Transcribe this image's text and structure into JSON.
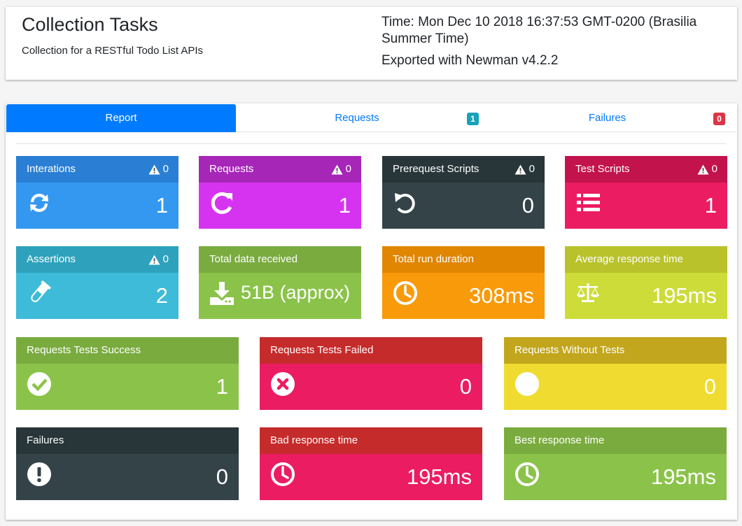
{
  "header": {
    "title": "Collection Tasks",
    "description": "Collection for a RESTful Todo List APIs",
    "time": "Time: Mon Dec 10 2018 16:37:53 GMT-0200 (Brasilia Summer Time)",
    "exported": "Exported with Newman v4.2.2"
  },
  "tabs": [
    {
      "label": "Report",
      "active": true
    },
    {
      "label": "Requests",
      "badge": "1",
      "badge_color": "#17a2b8"
    },
    {
      "label": "Failures",
      "badge": "0",
      "badge_color": "#dc3545"
    }
  ],
  "row1": [
    {
      "title": "Interations",
      "warnings": "0",
      "value": "1",
      "icon": "sync-icon",
      "head_color": "#2a7fd4",
      "body_color": "#3498f0"
    },
    {
      "title": "Requests",
      "warnings": "0",
      "value": "1",
      "icon": "redo-icon",
      "head_color": "#a626b8",
      "body_color": "#d633f0"
    },
    {
      "title": "Prerequest Scripts",
      "warnings": "0",
      "value": "0",
      "icon": "undo-icon",
      "head_color": "#283539",
      "body_color": "#344348"
    },
    {
      "title": "Test Scripts",
      "warnings": "0",
      "value": "1",
      "icon": "list-icon",
      "head_color": "#c2134d",
      "body_color": "#eb1c62"
    }
  ],
  "row2": [
    {
      "title": "Assertions",
      "warnings": "0",
      "value": "2",
      "icon": "flask-icon",
      "head_color": "#2ea2bc",
      "body_color": "#3ebbd8"
    },
    {
      "title": "Total data received",
      "value": "51B (approx)",
      "icon": "download-icon",
      "head_color": "#7aab3f",
      "body_color": "#8bc34a"
    },
    {
      "title": "Total run duration",
      "value": "308ms",
      "icon": "clock-icon",
      "head_color": "#e08600",
      "body_color": "#f89a0a"
    },
    {
      "title": "Average response time",
      "value": "195ms",
      "icon": "balance-icon",
      "head_color": "#b9c22a",
      "body_color": "#cddc39"
    }
  ],
  "row3": [
    {
      "title": "Requests Tests Success",
      "value": "1",
      "icon": "check-circle-icon",
      "head_color": "#7aab3f",
      "body_color": "#8bc34a"
    },
    {
      "title": "Requests Tests Failed",
      "value": "0",
      "icon": "times-circle-icon",
      "head_color": "#c62b2b",
      "body_color": "#eb1c62"
    },
    {
      "title": "Requests Without Tests",
      "value": "0",
      "icon": "circle-icon",
      "head_color": "#c2a61d",
      "body_color": "#f0dc30"
    }
  ],
  "row4": [
    {
      "title": "Failures",
      "value": "0",
      "icon": "exclamation-circle-icon",
      "head_color": "#283539",
      "body_color": "#344348"
    },
    {
      "title": "Bad response time",
      "value": "195ms",
      "icon": "clock-icon",
      "head_color": "#c62b2b",
      "body_color": "#eb1c62"
    },
    {
      "title": "Best response time",
      "value": "195ms",
      "icon": "clock-icon",
      "head_color": "#7aab3f",
      "body_color": "#8bc34a"
    }
  ]
}
